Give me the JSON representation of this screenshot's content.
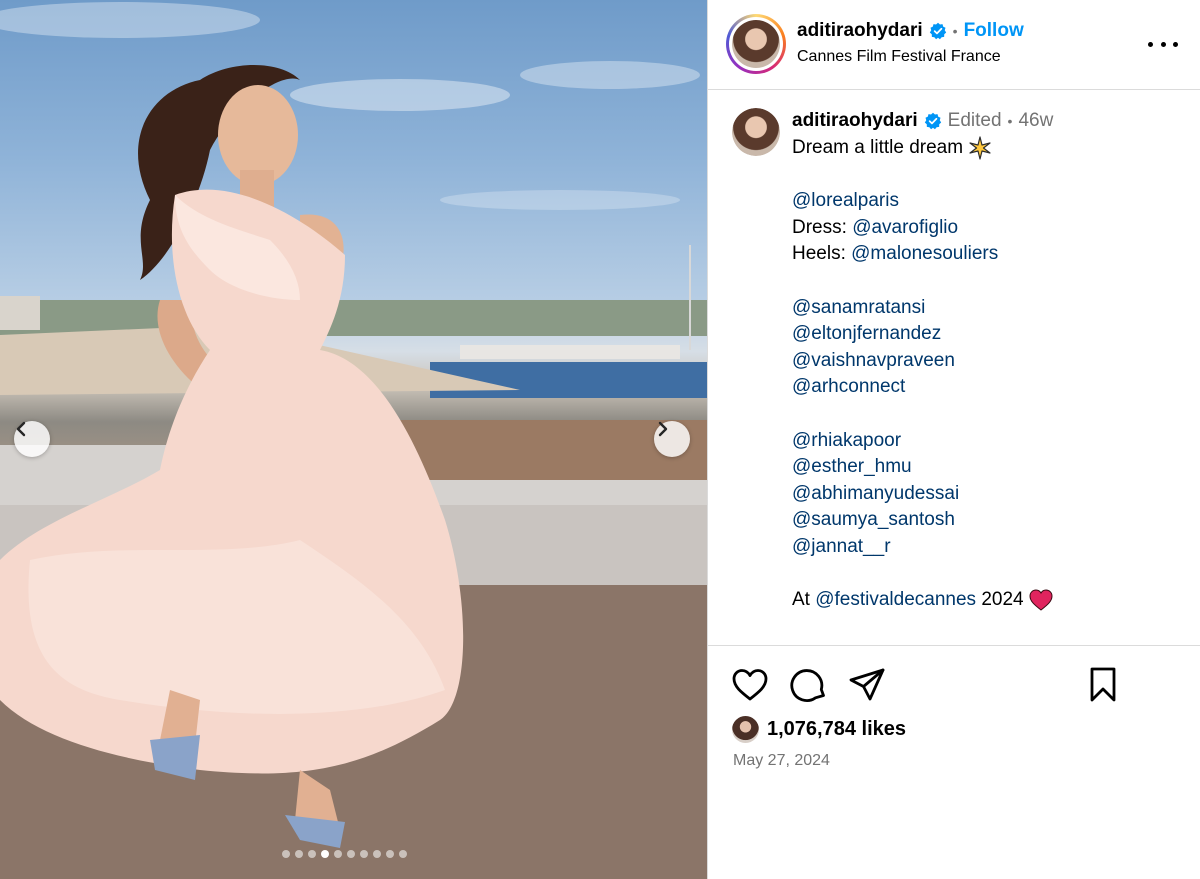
{
  "post": {
    "username": "aditiraohydari",
    "follow_label": "Follow",
    "location": "Cannes Film Festival France",
    "caption_author": "aditiraohydari",
    "edited_label": "Edited",
    "age": "46w",
    "caption_lines": {
      "l1": "Dream a little dream",
      "l3": "@lorealparis",
      "l4_prefix": "Dress:",
      "l4_mention": "@avarofiglio",
      "l5_prefix": "Heels:",
      "l5_mention": "@malonesouliers",
      "l7": "@sanamratansi",
      "l8": "@eltonjfernandez",
      "l9": "@vaishnavpraveen",
      "l10": "@arhconnect",
      "l12": "@rhiakapoor",
      "l13": "@esther_hmu",
      "l14": "@abhimanyudessai",
      "l15": "@saumya_santosh",
      "l16": "@jannat__r",
      "l18_prefix": "At",
      "l18_mention": "@festivaldecannes",
      "l18_suffix": "2024"
    },
    "likes": "1,076,784 likes",
    "date": "May 27, 2024"
  },
  "carousel": {
    "slide_count": 10,
    "active_index": 3
  },
  "colors": {
    "follow": "#0095f6",
    "mention": "#00376b",
    "verified": "#0095f6",
    "muted": "#737373",
    "heart_emoji": "#e0245e"
  },
  "icons": {
    "verified": "verified-badge-icon",
    "more": "more-options-icon",
    "like": "heart-icon",
    "comment": "comment-icon",
    "share": "send-icon",
    "save": "bookmark-icon",
    "prev": "chevron-left-icon",
    "next": "chevron-right-icon",
    "sparkle": "sparkle-emoji-icon",
    "heart_emoji": "red-heart-emoji-icon"
  }
}
